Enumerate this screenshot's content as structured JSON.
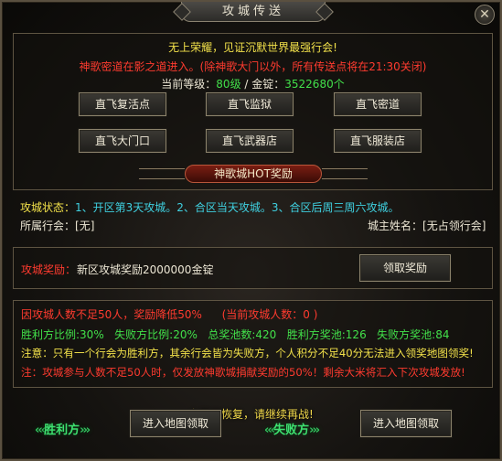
{
  "window": {
    "title": "攻城传送",
    "close_icon": "close-icon"
  },
  "header": {
    "line1": "无上荣耀，见证沉默世界最强行会!",
    "line2": "神歌密道在影之道进入。(除神歌大门以外，所有传送点将在21:30关闭)",
    "level_label": "当前等级：",
    "level_value": "80级",
    "divider": " / ",
    "ingot_label": "金锭：",
    "ingot_value": "3522680个"
  },
  "teleport_buttons": [
    "直飞复活点",
    "直飞监狱",
    "直飞密道",
    "直飞大门口",
    "直飞武器店",
    "直飞服装店"
  ],
  "hot_banner": "神歌城HOT奖励",
  "siege_info": {
    "status_label": "攻城状态：",
    "status_value": "1、开区第3天攻城。2、合区当天攻城。3、合区后周三周六攻城。",
    "guild_label": "所属行会：",
    "guild_value": "[无]",
    "lord_label": "城主姓名：",
    "lord_value": "[无占领行会]"
  },
  "reward": {
    "label": "攻城奖励：",
    "value": "新区攻城奖励2000000金锭",
    "button": "领取奖励"
  },
  "stats": {
    "notice_red": "因攻城人数不足50人，奖励降低50%",
    "current_count": "(当前攻城人数：0 )",
    "win_ratio": "胜利方比例:30%",
    "lose_ratio": "失败方比例:20%",
    "total_pool": "总奖池数:420",
    "win_pool": "胜利方奖池:126",
    "lose_pool": "失败方奖池:84",
    "note1": "注意：只有一个行会为胜利方，其余行会皆为失败方，个人积分不足40分无法进入领奖地图领奖!",
    "note2": "注：攻城参与人数不足50人时，仅发放神歌城捐献奖励的50%！剩余大米将汇入下次攻城发放!",
    "overlay": "血量已恢复，请继续再战!"
  },
  "bottom": {
    "winner_label": "胜利方",
    "loser_label": "失败方",
    "enter_winner": "进入地图领取",
    "enter_loser": "进入地图领取"
  },
  "colors": {
    "yellow": "#f2e14a",
    "red": "#ff3b2f",
    "green": "#42e04a",
    "cyan": "#3fd0e0"
  }
}
